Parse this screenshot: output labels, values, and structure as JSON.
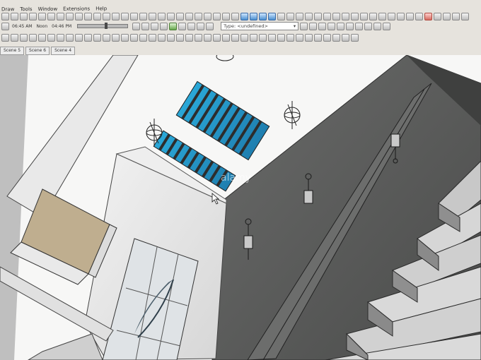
{
  "menu": {
    "items": [
      "Draw",
      "Tools",
      "Window",
      "Extensions",
      "Help"
    ]
  },
  "shadow_bar": {
    "time_start": "06:45 AM",
    "noon": "Noon",
    "time_end": "04:46 PM"
  },
  "entity_info": {
    "type_label": "Type: <undefined>"
  },
  "scenes": [
    "Scene 5",
    "Scene 6",
    "Scene 4"
  ],
  "watermark": "alamy",
  "colors": {
    "skylight_glass": "#29a7d6",
    "wall_concrete": "#5c5d5c",
    "ceiling": "#f7f7f6",
    "wood": "#bfae8f"
  }
}
